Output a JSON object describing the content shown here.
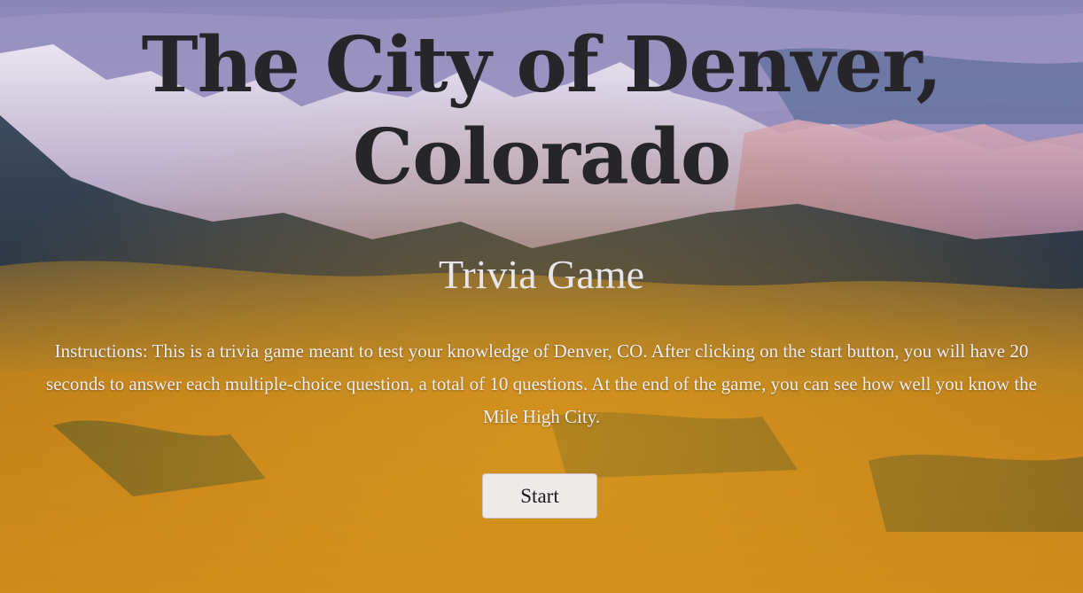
{
  "header": {
    "title_line1": "The City of Denver,",
    "title_line2": "Colorado",
    "subtitle": "Trivia Game"
  },
  "instructions": {
    "text": "Instructions: This is a trivia game meant to test your knowledge of Denver, CO. After clicking on the start button, you will have 20 seconds to answer each multiple-choice question, a total of 10 questions. At the end of the game, you can see how well you know the Mile High City."
  },
  "controls": {
    "start_label": "Start"
  },
  "colors": {
    "title": "#26262a",
    "subtitle": "#e8e6ec",
    "button_bg": "#efeaea",
    "sky": "#8c86b8",
    "foliage": "#d9931c"
  }
}
